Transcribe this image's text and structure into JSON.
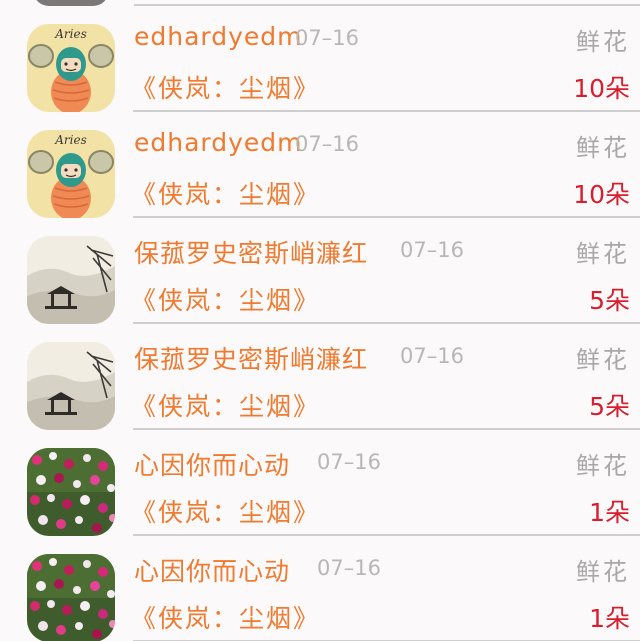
{
  "gift_list": {
    "items": [
      {
        "nickname": "edhardyedm",
        "date": "07–16",
        "gift_type": "鲜花",
        "work_title": "《侠岚：尘烟》",
        "quantity": "10朵",
        "avatar": "aries-cartoon-avatar"
      },
      {
        "nickname": "edhardyedm",
        "date": "07–16",
        "gift_type": "鲜花",
        "work_title": "《侠岚：尘烟》",
        "quantity": "10朵",
        "avatar": "aries-cartoon-avatar"
      },
      {
        "nickname": "保菰罗史密斯峭濂红",
        "date": "07–16",
        "gift_type": "鲜花",
        "work_title": "《侠岚：尘烟》",
        "quantity": "5朵",
        "avatar": "ink-landscape-avatar"
      },
      {
        "nickname": "保菰罗史密斯峭濂红",
        "date": "07–16",
        "gift_type": "鲜花",
        "work_title": "《侠岚：尘烟》",
        "quantity": "5朵",
        "avatar": "ink-landscape-avatar"
      },
      {
        "nickname": "心因你而心动",
        "date": "07–16",
        "gift_type": "鲜花",
        "work_title": "《侠岚：尘烟》",
        "quantity": "1朵",
        "avatar": "flowers-photo-avatar"
      },
      {
        "nickname": "心因你而心动",
        "date": "07–16",
        "gift_type": "鲜花",
        "work_title": "《侠岚：尘烟》",
        "quantity": "1朵",
        "avatar": "flowers-photo-avatar"
      }
    ]
  },
  "avatar_labels": {
    "aries": "Aries"
  },
  "colors": {
    "accent_orange": "#f07a2f",
    "quantity_red": "#d81e2e",
    "muted_gray": "#b7b7b7",
    "background": "#fbf9f9"
  }
}
